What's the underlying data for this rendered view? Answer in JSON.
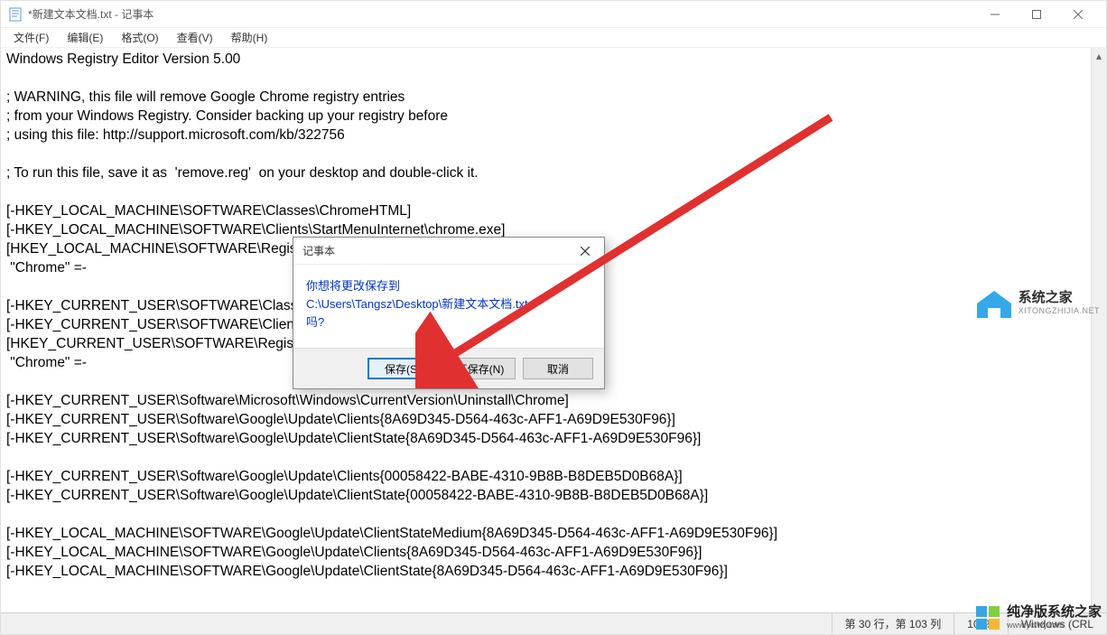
{
  "window": {
    "title": "*新建文本文档.txt - 记事本"
  },
  "menu": {
    "file": "文件(F)",
    "edit": "编辑(E)",
    "format": "格式(O)",
    "view": "查看(V)",
    "help": "帮助(H)"
  },
  "editor": {
    "content": "Windows Registry Editor Version 5.00\n\n; WARNING, this file will remove Google Chrome registry entries\n; from your Windows Registry. Consider backing up your registry before\n; using this file: http://support.microsoft.com/kb/322756\n\n; To run this file, save it as  'remove.reg'  on your desktop and double-click it.\n\n[-HKEY_LOCAL_MACHINE\\SOFTWARE\\Classes\\ChromeHTML]\n[-HKEY_LOCAL_MACHINE\\SOFTWARE\\Clients\\StartMenuInternet\\chrome.exe]\n[HKEY_LOCAL_MACHINE\\SOFTWARE\\RegisteredApplications]\n \"Chrome\" =-\n\n[-HKEY_CURRENT_USER\\SOFTWARE\\Classes\\ChromeHTML]\n[-HKEY_CURRENT_USER\\SOFTWARE\\Clients\\StartMenuInternet\\chrome.exe]\n[HKEY_CURRENT_USER\\SOFTWARE\\RegisteredApplications]\n \"Chrome\" =-\n\n[-HKEY_CURRENT_USER\\Software\\Microsoft\\Windows\\CurrentVersion\\Uninstall\\Chrome]\n[-HKEY_CURRENT_USER\\Software\\Google\\Update\\Clients{8A69D345-D564-463c-AFF1-A69D9E530F96}]\n[-HKEY_CURRENT_USER\\Software\\Google\\Update\\ClientState{8A69D345-D564-463c-AFF1-A69D9E530F96}]\n\n[-HKEY_CURRENT_USER\\Software\\Google\\Update\\Clients{00058422-BABE-4310-9B8B-B8DEB5D0B68A}]\n[-HKEY_CURRENT_USER\\Software\\Google\\Update\\ClientState{00058422-BABE-4310-9B8B-B8DEB5D0B68A}]\n\n[-HKEY_LOCAL_MACHINE\\SOFTWARE\\Google\\Update\\ClientStateMedium{8A69D345-D564-463c-AFF1-A69D9E530F96}]\n[-HKEY_LOCAL_MACHINE\\SOFTWARE\\Google\\Update\\Clients{8A69D345-D564-463c-AFF1-A69D9E530F96}]\n[-HKEY_LOCAL_MACHINE\\SOFTWARE\\Google\\Update\\ClientState{8A69D345-D564-463c-AFF1-A69D9E530F96}]\n"
  },
  "status": {
    "position": "第 30 行，第 103 列",
    "zoom": "100%",
    "lineend": "Windows (CRL"
  },
  "dialog": {
    "title": "记事本",
    "line1": "你想将更改保存到",
    "line2": "C:\\Users\\Tangsz\\Desktop\\新建文本文档.txt",
    "line3": "吗?",
    "save": "保存(S)",
    "nosave": "不保存(N)",
    "cancel": "取消"
  },
  "watermark1": {
    "title": "系统之家",
    "sub": "XITONGZHIJIA.NET"
  },
  "watermark2": {
    "title": "纯净版系统之家",
    "sub": "www.ycwzj.com"
  }
}
